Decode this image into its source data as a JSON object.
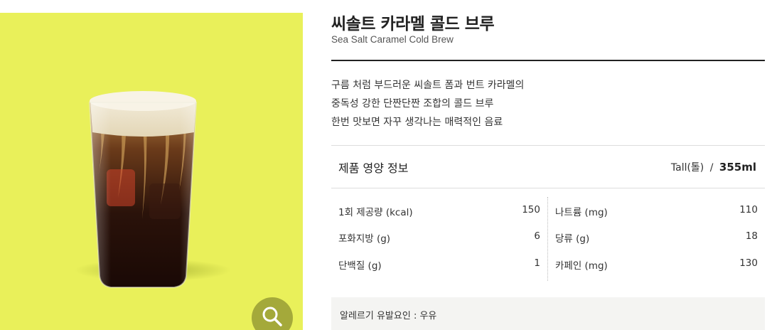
{
  "product": {
    "name_ko": "씨솔트 카라멜 콜드 브루",
    "name_en": "Sea Salt Caramel Cold Brew",
    "description_lines": [
      "구름 처럼 부드러운 씨솔트 폼과 번트 카라멜의",
      "중독성 강한 단짠단짠 조합의 콜드 브루",
      "한번 맛보면 자꾸 생각나는 매력적인 음료"
    ]
  },
  "image": {
    "background_color": "#e9f05a",
    "zoom_icon": "magnifier-icon",
    "zoom_button_color": "#a4a93a"
  },
  "nutrition": {
    "title": "제품 영양 정보",
    "size_label": "Tall(톨)",
    "size_separator": "/",
    "volume": "355ml",
    "left_rows": [
      {
        "label": "1회 제공량 (kcal)",
        "value": "150"
      },
      {
        "label": "포화지방 (g)",
        "value": "6"
      },
      {
        "label": "단백질 (g)",
        "value": "1"
      }
    ],
    "right_rows": [
      {
        "label": "나트륨 (mg)",
        "value": "110"
      },
      {
        "label": "당류 (g)",
        "value": "18"
      },
      {
        "label": "카페인 (mg)",
        "value": "130"
      }
    ]
  },
  "allergy": {
    "text": "알레르기 유발요인 : 우유"
  }
}
